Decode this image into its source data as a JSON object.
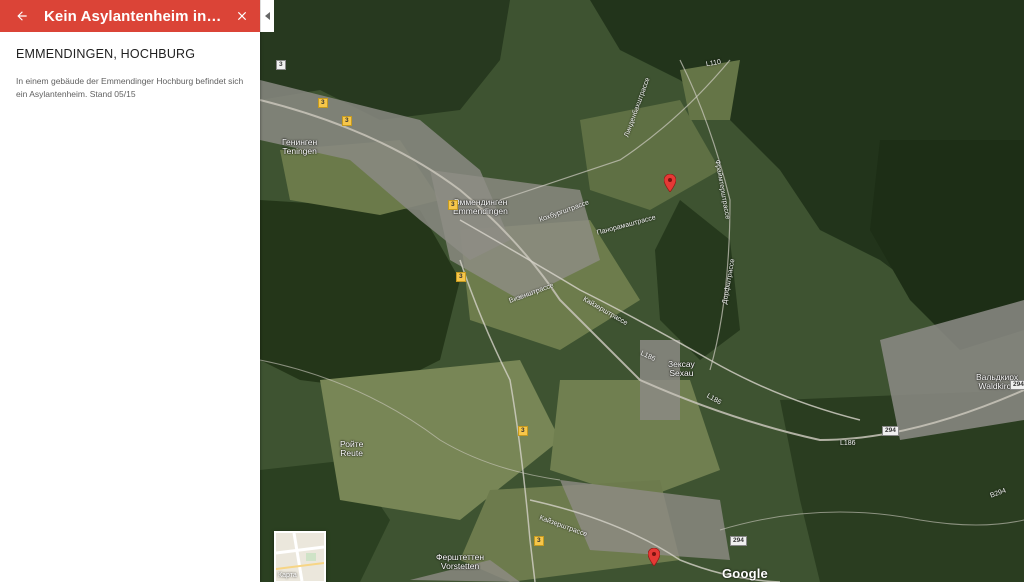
{
  "panel": {
    "title": "Kein Asylantenheim in mein...",
    "place_name": "EMMENDINGEN, HOCHBURG",
    "description": "In einem gebäude der Emmendinger Hochburg befindet sich ein Asylantenheim. Stand 05/15",
    "accent": "#db4437"
  },
  "map": {
    "places": [
      {
        "cyr": "Генинген",
        "lat": "Teningen"
      },
      {
        "cyr": "Эммендинген",
        "lat": "Emmendingen"
      },
      {
        "cyr": "Зексау",
        "lat": "Sexau"
      },
      {
        "cyr": "Вальдкирх",
        "lat": "Waldkirch"
      },
      {
        "cyr": "Ройте",
        "lat": "Reute"
      },
      {
        "cyr": "Ферштеттен",
        "lat": "Vorstetten"
      }
    ],
    "roads": {
      "kochburg": "Кохбургштрассе",
      "panorama": "Панорамаштрассе",
      "wiesen": "Визенштрассе",
      "kaisers": "Кайзерштрассе",
      "dorf": "Дорфштрассе",
      "lindenb": "Линденбахштрассе",
      "freiamt": "Фраймтерштрассе",
      "kaiser_south": "Кайзерштрассе",
      "l110": "L110",
      "b186a": "L186",
      "b186b": "L186",
      "b186c": "L186",
      "b294": "B294"
    },
    "shields": {
      "a": "3",
      "b": "3",
      "c": "3",
      "d": "3",
      "e": "3",
      "f": "3",
      "g": "3",
      "h": "294",
      "i": "294",
      "j": "294"
    },
    "map_type_label": "Карта",
    "attribution": "Google"
  }
}
